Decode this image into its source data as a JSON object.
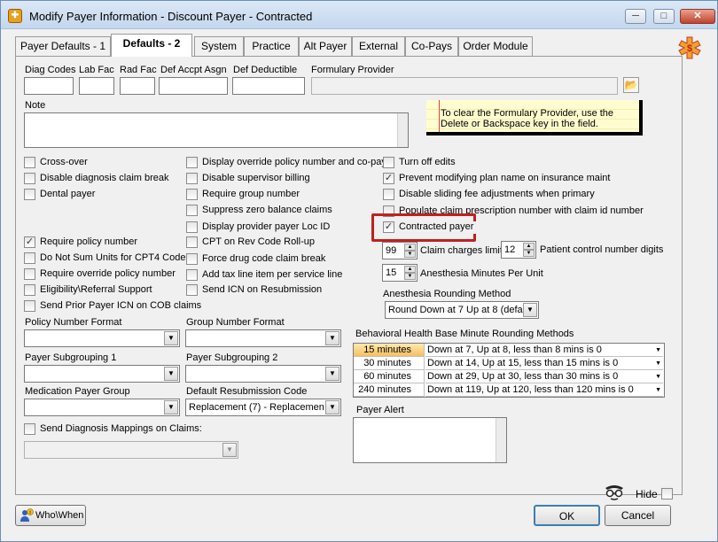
{
  "window": {
    "title": "Modify Payer Information - Discount Payer - Contracted",
    "buttons": {
      "minimize": "─",
      "maximize": "□",
      "close": "✕"
    }
  },
  "tabs": [
    {
      "label": "Payer Defaults - 1",
      "active": false
    },
    {
      "label": "Defaults - 2",
      "active": true
    },
    {
      "label": "System",
      "active": false
    },
    {
      "label": "Practice",
      "active": false
    },
    {
      "label": "Alt Payer",
      "active": false
    },
    {
      "label": "External",
      "active": false
    },
    {
      "label": "Co-Pays",
      "active": false
    },
    {
      "label": "Order Module",
      "active": false
    }
  ],
  "fields": {
    "diag_codes": {
      "label": "Diag Codes",
      "value": ""
    },
    "lab_fac": {
      "label": "Lab Fac",
      "value": ""
    },
    "rad_fac": {
      "label": "Rad Fac",
      "value": ""
    },
    "def_accpt_asgn": {
      "label": "Def Accpt Asgn",
      "value": ""
    },
    "def_deductible": {
      "label": "Def Deductible",
      "value": ""
    },
    "formulary_provider": {
      "label": "Formulary Provider",
      "value": ""
    },
    "note": {
      "label": "Note",
      "value": ""
    }
  },
  "sticky_note": {
    "line1": "To clear the Formulary Provider, use the",
    "line2": "Delete or Backspace key in the field."
  },
  "checkboxes": {
    "col1": [
      {
        "label": "Cross-over",
        "checked": false
      },
      {
        "label": "Disable diagnosis claim break",
        "checked": false
      },
      {
        "label": "Dental payer",
        "checked": false
      },
      {
        "label": "Require policy number",
        "checked": true
      },
      {
        "label": "Do Not Sum Units for CPT4 Code",
        "checked": false
      },
      {
        "label": "Require override policy number",
        "checked": false
      },
      {
        "label": "Eligibility\\Referral Support",
        "checked": false
      },
      {
        "label": "Send Prior Payer ICN on COB claims",
        "checked": false
      }
    ],
    "col2": [
      {
        "label": "Display override policy number and co-pay",
        "checked": false
      },
      {
        "label": "Disable supervisor billing",
        "checked": false
      },
      {
        "label": "Require group number",
        "checked": false
      },
      {
        "label": "Suppress zero balance claims",
        "checked": false
      },
      {
        "label": "Display provider payer Loc ID",
        "checked": false
      },
      {
        "label": "CPT on Rev Code Roll-up",
        "checked": false
      },
      {
        "label": "Force drug code claim break",
        "checked": false
      },
      {
        "label": "Add tax line item per service line",
        "checked": false
      },
      {
        "label": "Send ICN on Resubmission",
        "checked": false
      }
    ],
    "col3": [
      {
        "label": "Turn off edits",
        "checked": false
      },
      {
        "label": "Prevent modifying plan name on insurance maint",
        "checked": true
      },
      {
        "label": "Disable sliding fee adjustments when primary",
        "checked": false
      },
      {
        "label": "Populate claim prescription number with claim id number",
        "checked": false
      },
      {
        "label": "Contracted payer",
        "checked": true
      }
    ],
    "send_diag_mappings": {
      "label": "Send Diagnosis Mappings on Claims:",
      "checked": false
    }
  },
  "spinners": {
    "claim_charges_limit": {
      "value": "99",
      "label": "Claim charges limit"
    },
    "patient_control_digits": {
      "value": "12",
      "label": "Patient control number digits"
    },
    "anesthesia_minutes": {
      "value": "15",
      "label": "Anesthesia Minutes Per Unit"
    }
  },
  "anesthesia_rounding": {
    "label": "Anesthesia Rounding Method",
    "value": "Round Down at 7 Up at 8 (defa"
  },
  "selects": {
    "policy_number_format": {
      "label": "Policy Number Format",
      "value": ""
    },
    "group_number_format": {
      "label": "Group Number Format",
      "value": ""
    },
    "payer_subgrouping_1": {
      "label": "Payer Subgrouping 1",
      "value": ""
    },
    "payer_subgrouping_2": {
      "label": "Payer Subgrouping 2",
      "value": ""
    },
    "medication_payer_group": {
      "label": "Medication Payer Group",
      "value": ""
    },
    "default_resubmission_code": {
      "label": "Default Resubmission Code",
      "value": "Replacement (7) - Replacemen"
    },
    "diag_mappings_select": {
      "value": ""
    }
  },
  "behavioral_health": {
    "label": "Behavioral Health Base Minute Rounding Methods",
    "rows": [
      {
        "minutes": "15 minutes",
        "method": "Down at 7, Up at 8, less than 8 mins is 0"
      },
      {
        "minutes": "30 minutes",
        "method": "Down at 14, Up at 15, less than 15 mins is 0"
      },
      {
        "minutes": "60 minutes",
        "method": "Down at 29, Up at 30, less than 30 mins is 0"
      },
      {
        "minutes": "240 minutes",
        "method": "Down at 119, Up at 120, less than 120 mins is 0"
      }
    ]
  },
  "payer_alert": {
    "label": "Payer Alert",
    "value": ""
  },
  "footer": {
    "who_when": "Who\\When",
    "hide_label": "Hide",
    "ok": "OK",
    "cancel": "Cancel"
  },
  "colors": {
    "highlight": "#c02020",
    "sticky_bg": "#fffdd0",
    "accent": "#3c7fb1"
  }
}
